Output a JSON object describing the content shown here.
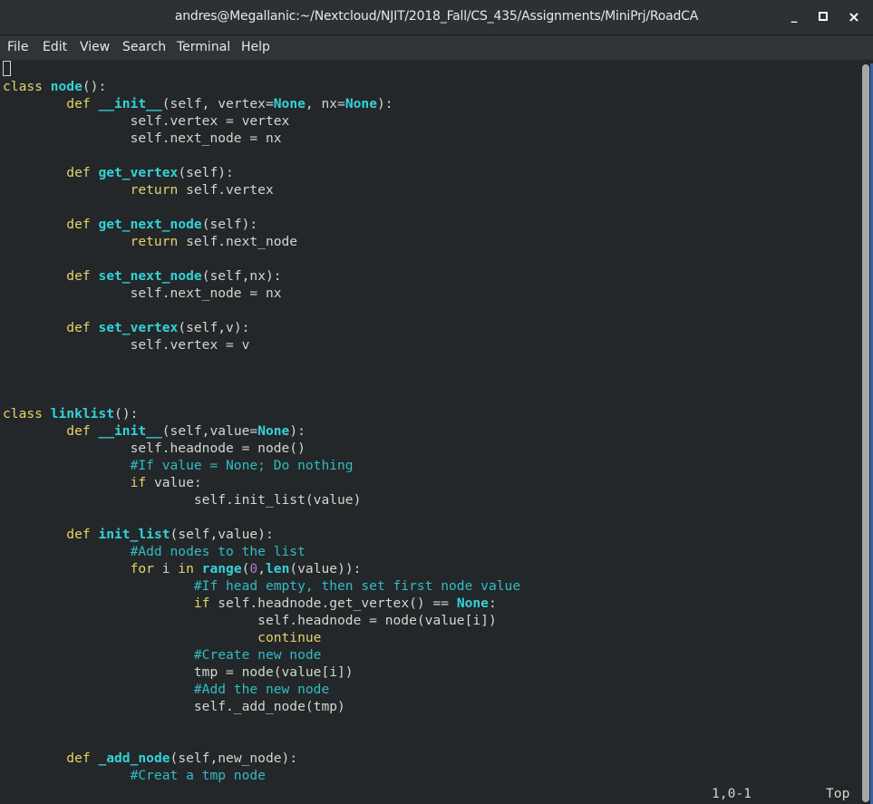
{
  "window": {
    "title": "andres@Megallanic:~/Nextcloud/NJIT/2018_Fall/CS_435/Assignments/MiniPrj/RoadCA",
    "controls": {
      "minimize": "_",
      "maximize": "□",
      "close": "×"
    }
  },
  "menubar": {
    "items": [
      "File",
      "Edit",
      "View",
      "Search",
      "Terminal",
      "Help"
    ]
  },
  "colors": {
    "background": "#232729",
    "keyword": "#e5d36a",
    "function": "#34d2d8",
    "comment": "#30bcc4",
    "number": "#a880c0",
    "text": "#d3d7cf"
  },
  "editor": {
    "lines": [
      [],
      [
        {
          "t": "class",
          "c": "kw"
        },
        {
          "t": " "
        },
        {
          "t": "node",
          "c": "fn"
        },
        {
          "t": "():"
        }
      ],
      [
        {
          "t": "\tdef",
          "c": "kw"
        },
        {
          "t": " "
        },
        {
          "t": "__init__",
          "c": "fn"
        },
        {
          "t": "(self, vertex="
        },
        {
          "t": "None",
          "c": "fn"
        },
        {
          "t": ", nx="
        },
        {
          "t": "None",
          "c": "fn"
        },
        {
          "t": "):"
        }
      ],
      [
        {
          "t": "\t\tself.vertex = vertex"
        }
      ],
      [
        {
          "t": "\t\tself.next_node = nx"
        }
      ],
      [],
      [
        {
          "t": "\tdef",
          "c": "kw"
        },
        {
          "t": " "
        },
        {
          "t": "get_vertex",
          "c": "fn"
        },
        {
          "t": "(self):"
        }
      ],
      [
        {
          "t": "\t\treturn",
          "c": "kw"
        },
        {
          "t": " self.vertex"
        }
      ],
      [],
      [
        {
          "t": "\tdef",
          "c": "kw"
        },
        {
          "t": " "
        },
        {
          "t": "get_next_node",
          "c": "fn"
        },
        {
          "t": "(self):"
        }
      ],
      [
        {
          "t": "\t\treturn",
          "c": "kw"
        },
        {
          "t": " self.next_node"
        }
      ],
      [],
      [
        {
          "t": "\tdef",
          "c": "kw"
        },
        {
          "t": " "
        },
        {
          "t": "set_next_node",
          "c": "fn"
        },
        {
          "t": "(self,nx):"
        }
      ],
      [
        {
          "t": "\t\tself.next_node = nx"
        }
      ],
      [],
      [
        {
          "t": "\tdef",
          "c": "kw"
        },
        {
          "t": " "
        },
        {
          "t": "set_vertex",
          "c": "fn"
        },
        {
          "t": "(self,v):"
        }
      ],
      [
        {
          "t": "\t\tself.vertex = v"
        }
      ],
      [],
      [],
      [],
      [
        {
          "t": "class",
          "c": "kw"
        },
        {
          "t": " "
        },
        {
          "t": "linklist",
          "c": "fn"
        },
        {
          "t": "():"
        }
      ],
      [
        {
          "t": "\tdef",
          "c": "kw"
        },
        {
          "t": " "
        },
        {
          "t": "__init__",
          "c": "fn"
        },
        {
          "t": "(self,value="
        },
        {
          "t": "None",
          "c": "fn"
        },
        {
          "t": "):"
        }
      ],
      [
        {
          "t": "\t\tself.headnode = node()"
        }
      ],
      [
        {
          "t": "\t\t#If value = None; Do nothing",
          "c": "cm"
        }
      ],
      [
        {
          "t": "\t\tif",
          "c": "kw"
        },
        {
          "t": " value:"
        }
      ],
      [
        {
          "t": "\t\t\tself.init_list(value)"
        }
      ],
      [],
      [
        {
          "t": "\tdef",
          "c": "kw"
        },
        {
          "t": " "
        },
        {
          "t": "init_list",
          "c": "fn"
        },
        {
          "t": "(self,value):"
        }
      ],
      [
        {
          "t": "\t\t#Add nodes to the list",
          "c": "cm"
        }
      ],
      [
        {
          "t": "\t\tfor",
          "c": "kw"
        },
        {
          "t": " i "
        },
        {
          "t": "in",
          "c": "kw"
        },
        {
          "t": " "
        },
        {
          "t": "range",
          "c": "fn"
        },
        {
          "t": "("
        },
        {
          "t": "0",
          "c": "num"
        },
        {
          "t": ","
        },
        {
          "t": "len",
          "c": "fn"
        },
        {
          "t": "(value)):"
        }
      ],
      [
        {
          "t": "\t\t\t#If head empty, then set first node value",
          "c": "cm"
        }
      ],
      [
        {
          "t": "\t\t\tif",
          "c": "kw"
        },
        {
          "t": " self.headnode.get_vertex() == "
        },
        {
          "t": "None",
          "c": "fn"
        },
        {
          "t": ":"
        }
      ],
      [
        {
          "t": "\t\t\t\tself.headnode = node(value[i])"
        }
      ],
      [
        {
          "t": "\t\t\t\tcontinue",
          "c": "kw"
        }
      ],
      [
        {
          "t": "\t\t\t#Create new node",
          "c": "cm"
        }
      ],
      [
        {
          "t": "\t\t\ttmp = node(value[i])"
        }
      ],
      [
        {
          "t": "\t\t\t#Add the new node",
          "c": "cm"
        }
      ],
      [
        {
          "t": "\t\t\tself._add_node(tmp)"
        }
      ],
      [],
      [],
      [
        {
          "t": "\tdef",
          "c": "kw"
        },
        {
          "t": " "
        },
        {
          "t": "_add_node",
          "c": "fn"
        },
        {
          "t": "(self,new_node):"
        }
      ],
      [
        {
          "t": "\t\t#Creat a tmp node",
          "c": "cm"
        }
      ]
    ]
  },
  "statusline": {
    "position": "1,0-1",
    "scroll": "Top"
  }
}
